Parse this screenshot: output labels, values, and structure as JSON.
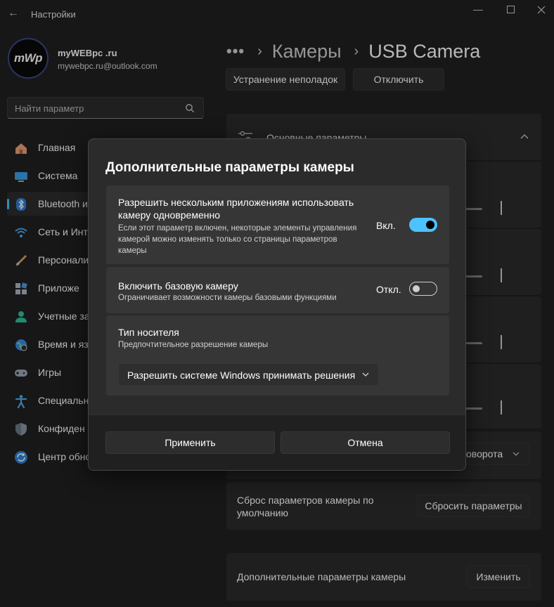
{
  "window": {
    "title": "Настройки",
    "back_icon": "arrow-left-icon",
    "minimize_icon": "minimize-icon",
    "maximize_icon": "maximize-icon",
    "close_icon": "close-icon"
  },
  "user": {
    "avatar_text": "mWp",
    "name": "myWEBpc .ru",
    "email": "mywebpc.ru@outlook.com"
  },
  "search": {
    "placeholder": "Найти параметр",
    "icon": "search-icon"
  },
  "sidebar": {
    "active_index": 2,
    "items": [
      {
        "label": "Главная",
        "icon": "home-icon"
      },
      {
        "label": "Система",
        "icon": "system-icon"
      },
      {
        "label": "Bluetooth и",
        "icon": "bluetooth-icon"
      },
      {
        "label": "Сеть и Инте",
        "icon": "network-icon"
      },
      {
        "label": "Персонали",
        "icon": "brush-icon"
      },
      {
        "label": "Приложе",
        "icon": "apps-icon"
      },
      {
        "label": "Учетные за",
        "icon": "accounts-icon"
      },
      {
        "label": "Время и язы",
        "icon": "time-language-icon"
      },
      {
        "label": "Игры",
        "icon": "gaming-icon"
      },
      {
        "label": "Специальн",
        "icon": "accessibility-icon"
      },
      {
        "label": "Конфиден",
        "icon": "shield-icon"
      },
      {
        "label": "Центр обно",
        "icon": "update-icon"
      }
    ]
  },
  "breadcrumb": {
    "dots": "•••",
    "items": [
      "Камеры",
      "USB Camera"
    ]
  },
  "main": {
    "troubleshoot_button": "Устранение неполадок",
    "disable_button": "Отключить",
    "basic_settings_label": "Основные параметры",
    "rotation_dropdown_fragment": "оворота",
    "reset_label": "Сброс параметров камеры по умолчанию",
    "reset_button": "Сбросить параметры",
    "advanced_label": "Дополнительные параметры камеры",
    "advanced_button": "Изменить"
  },
  "dialog": {
    "title": "Дополнительные параметры камеры",
    "multi_app": {
      "title": "Разрешить нескольким приложениям использовать камеру одновременно",
      "description": "Если этот параметр включен, некоторые элементы управления камерой можно изменять только со страницы параметров камеры",
      "state_text": "Вкл.",
      "state": true
    },
    "basic_camera": {
      "title": "Включить базовую камеру",
      "description": "Ограничивает возможности камеры базовыми функциями",
      "state_text": "Откл.",
      "state": false
    },
    "media_type": {
      "title": "Тип носителя",
      "description": "Предпочтительное разрешение камеры",
      "selected": "Разрешить системе Windows принимать решения"
    },
    "apply_button": "Применить",
    "cancel_button": "Отмена"
  },
  "colors": {
    "accent": "#4cc2ff",
    "background": "#202020",
    "card": "#2b2b2b"
  }
}
